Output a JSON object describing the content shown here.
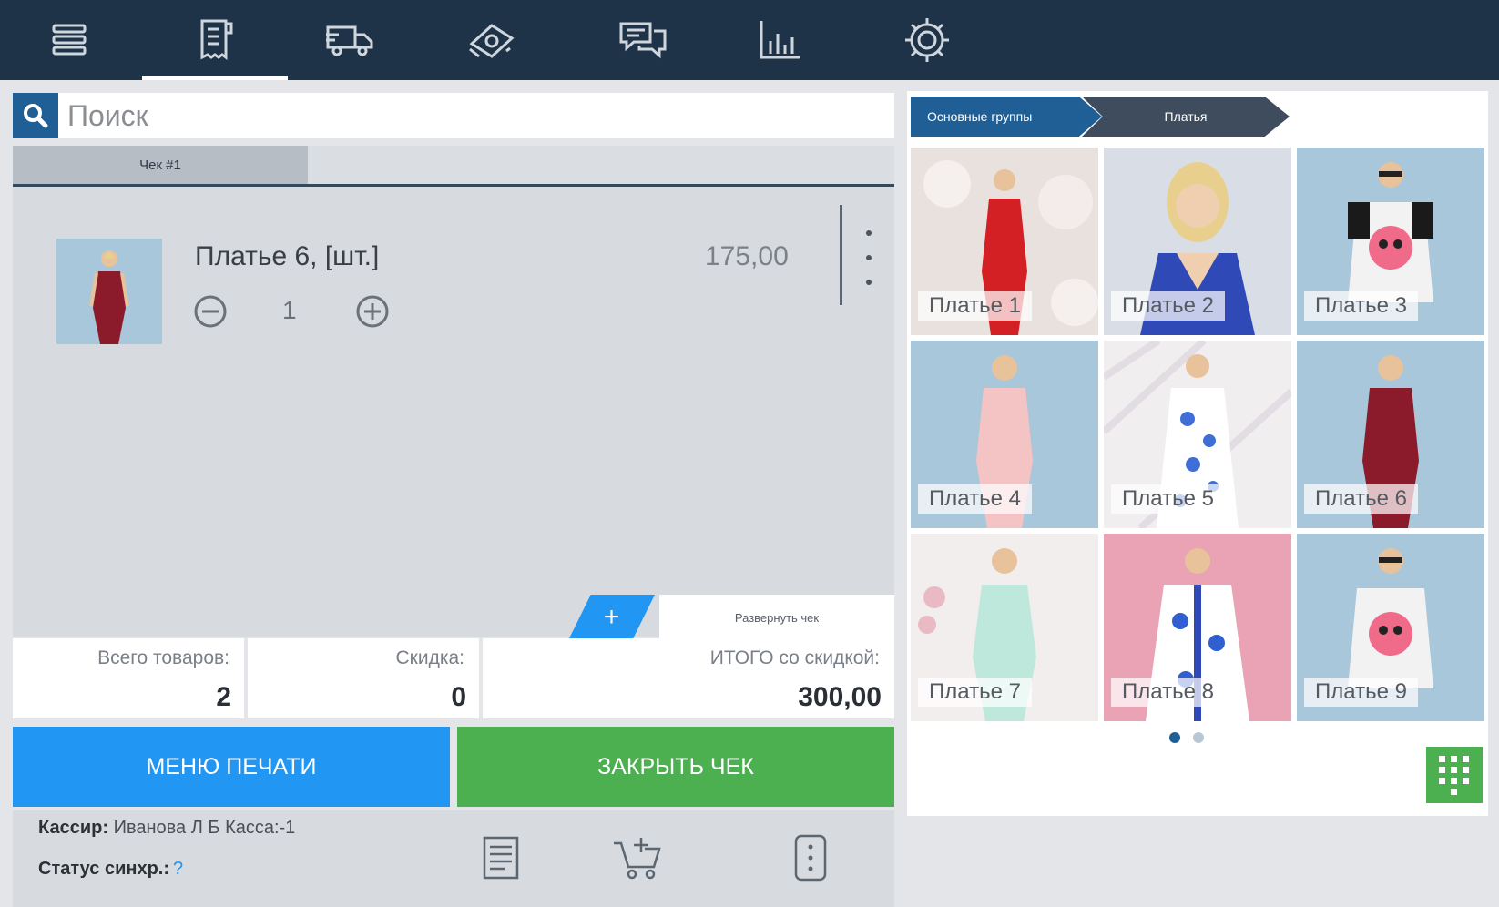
{
  "nav": {
    "items": [
      {
        "name": "menu-icon"
      },
      {
        "name": "receipt-icon",
        "active": true
      },
      {
        "name": "delivery-truck-icon"
      },
      {
        "name": "money-icon"
      },
      {
        "name": "chat-icon"
      },
      {
        "name": "bar-chart-icon"
      },
      {
        "name": "settings-gear-icon"
      }
    ]
  },
  "search": {
    "placeholder": "Поиск"
  },
  "tabs": [
    {
      "label": "Чек #1"
    }
  ],
  "order": {
    "item": {
      "name": "Платье 6, [шт.]",
      "price": "175,00",
      "quantity": "1"
    },
    "expand_label": "Развернуть чек",
    "expand_plus": "+"
  },
  "totals": {
    "items_label": "Всего товаров:",
    "items_value": "2",
    "discount_label": "Скидка:",
    "discount_value": "0",
    "total_label": "ИТОГО со скидкой:",
    "total_value": "300,00"
  },
  "actions": {
    "print_label": "МЕНЮ ПЕЧАТИ",
    "close_label": "ЗАКРЫТЬ ЧЕК"
  },
  "footer": {
    "cashier_key": "Кассир:",
    "cashier_value": "Иванова Л Б Касса:-1",
    "sync_key": "Статус синхр.:",
    "sync_value": "?"
  },
  "catalog": {
    "breadcrumbs": [
      "Основные группы",
      "Платья"
    ],
    "products": [
      {
        "label": "Платье 1"
      },
      {
        "label": "Платье 2"
      },
      {
        "label": "Платье 3"
      },
      {
        "label": "Платье 4"
      },
      {
        "label": "Платье 5"
      },
      {
        "label": "Платье 6"
      },
      {
        "label": "Платье 7"
      },
      {
        "label": "Платье 8"
      },
      {
        "label": "Платье 9"
      }
    ],
    "page_count": 2,
    "current_page": 1
  },
  "colors": {
    "topbar": "#1e3347",
    "accent_blue": "#2196f3",
    "accent_green": "#4caf50",
    "dark_blue": "#1f5f95"
  }
}
